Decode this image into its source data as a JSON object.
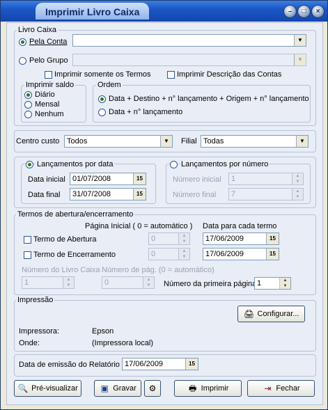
{
  "window": {
    "title": "Imprimir Livro Caixa",
    "controls": [
      "minimize-icon",
      "restore-icon",
      "close-icon"
    ]
  },
  "livro_caixa": {
    "label": "Livro Caixa",
    "pela_conta": "Pela Conta",
    "pelo_grupo": "Pelo Grupo",
    "pela_conta_value": "",
    "pelo_grupo_value": "",
    "imprimir_termos": "Imprimir somente os Termos",
    "imprimir_descricao": "Imprimir Descrição das Contas",
    "saldo": {
      "label": "Imprimir saldo",
      "options": [
        "Diário",
        "Mensal",
        "Nenhum"
      ],
      "selected": "Diário"
    },
    "ordem": {
      "label": "Ordem",
      "options": [
        "Data + Destino + n° lançamento + Origem + n° lançamento",
        "Data + n° lançamento"
      ],
      "selected": "Data + Destino + n° lançamento + Origem + n° lançamento"
    }
  },
  "filtros": {
    "centro_custo_label": "Centro custo",
    "centro_custo_value": "Todos",
    "filial_label": "Filial",
    "filial_value": "Todas"
  },
  "lancamentos": {
    "por_data": "Lançamentos por data",
    "data_inicial_label": "Data inicial",
    "data_inicial": "01/07/2008",
    "data_final_label": "Data final",
    "data_final": "31/07/2008",
    "por_numero": "Lançamentos por número",
    "numero_inicial_label": "Número inicial",
    "numero_inicial": "1",
    "numero_final_label": "Número final",
    "numero_final": "7"
  },
  "termos": {
    "label": "Termos de abertura/encerramento",
    "pagina_inicial_label": "Página Inicial ( 0 = automático )",
    "data_termo_label": "Data para cada termo",
    "abertura": "Termo de Abertura",
    "abertura_pagina": "0",
    "abertura_data": "17/06/2009",
    "encerramento": "Termo de Encerramento",
    "encerramento_pagina": "0",
    "encerramento_data": "17/06/2009",
    "numero_livro_label": "Número do Livro Caixa",
    "numero_livro": "1",
    "numero_pag_label": "Número de pág. (0 = automático)",
    "numero_pag": "0",
    "primeira_pagina_label": "Número da primeira página",
    "primeira_pagina": "1"
  },
  "impressao": {
    "label": "Impressão",
    "configurar": "Configurar...",
    "impressora_label": "Impressora:",
    "impressora": "Epson",
    "onde_label": "Onde:",
    "onde": "(Impressora local)"
  },
  "emissao": {
    "label": "Data de emissão do Relatório",
    "value": "17/06/2009"
  },
  "buttons": {
    "previsualizar": "Pré-visualizar",
    "gravar": "Gravar",
    "imprimir": "Imprimir",
    "fechar": "Fechar"
  }
}
